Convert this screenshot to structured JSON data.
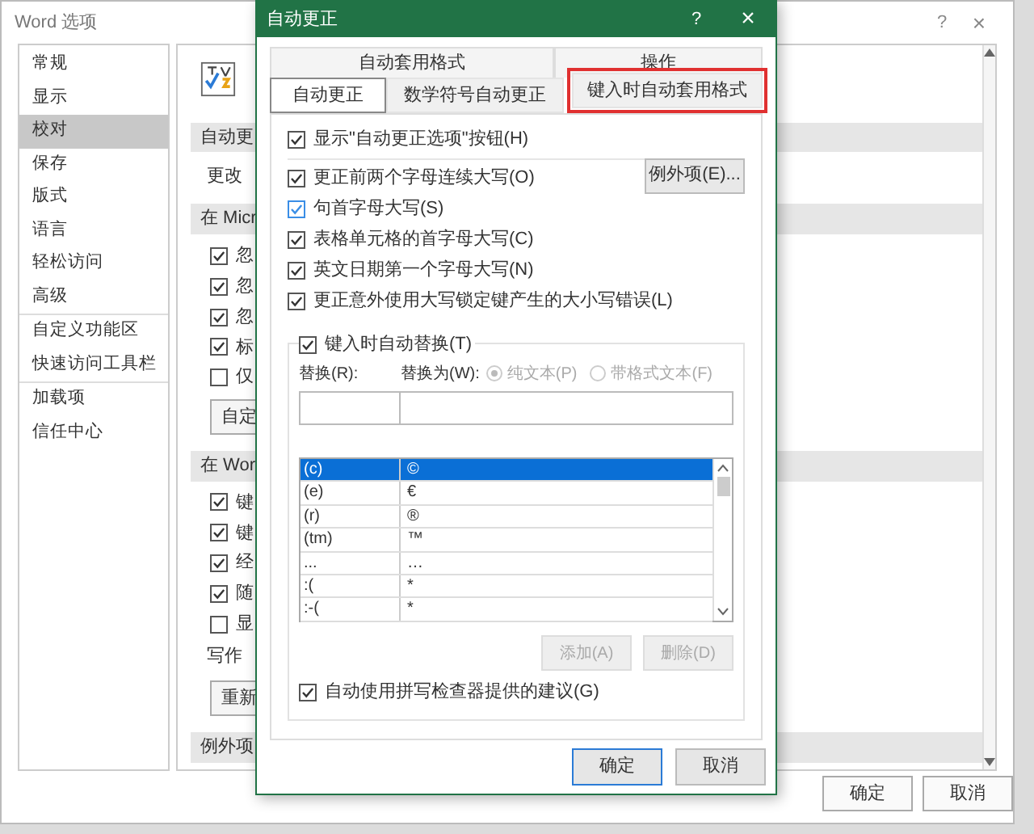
{
  "window": {
    "title": "Word 选项",
    "help": "?",
    "close": "×"
  },
  "sidebar": {
    "groups": [
      [
        {
          "label": "常规",
          "selected": false
        },
        {
          "label": "显示",
          "selected": false
        },
        {
          "label": "校对",
          "selected": true
        },
        {
          "label": "保存",
          "selected": false
        },
        {
          "label": "版式",
          "selected": false
        },
        {
          "label": "语言",
          "selected": false
        },
        {
          "label": "轻松访问",
          "selected": false
        },
        {
          "label": "高级",
          "selected": false
        }
      ],
      [
        {
          "label": "自定义功能区",
          "selected": false
        },
        {
          "label": "快速访问工具栏",
          "selected": false
        }
      ],
      [
        {
          "label": "加载项",
          "selected": false
        },
        {
          "label": "信任中心",
          "selected": false
        }
      ]
    ]
  },
  "main": {
    "rows": [
      {
        "kind": "section",
        "text": "自动更"
      },
      {
        "kind": "text",
        "text": "更改"
      },
      {
        "kind": "section",
        "text": "在 Micr"
      },
      {
        "kind": "check",
        "text": "忽",
        "checked": true
      },
      {
        "kind": "check",
        "text": "忽",
        "checked": true
      },
      {
        "kind": "check",
        "text": "忽",
        "checked": true
      },
      {
        "kind": "check",
        "text": "标",
        "checked": true
      },
      {
        "kind": "check",
        "text": "仅",
        "checked": false
      },
      {
        "kind": "button",
        "text": "自定"
      },
      {
        "kind": "section",
        "text": "在 Wor"
      },
      {
        "kind": "check",
        "text": "键",
        "checked": true
      },
      {
        "kind": "check",
        "text": "键",
        "checked": true
      },
      {
        "kind": "check",
        "text": "经",
        "checked": true
      },
      {
        "kind": "check",
        "text": "随",
        "checked": true
      },
      {
        "kind": "check",
        "text": "显",
        "checked": false
      },
      {
        "kind": "text",
        "text": "写作"
      },
      {
        "kind": "button",
        "text": "重新"
      },
      {
        "kind": "section",
        "text": "例外项"
      }
    ]
  },
  "footer_buttons": [
    "确定",
    "取消"
  ],
  "dialog": {
    "title": "自动更正",
    "help": "?",
    "close": "×",
    "tabs_back": [
      {
        "label": "自动套用格式",
        "selected": false
      },
      {
        "label": "操作",
        "selected": false
      }
    ],
    "tabs_front": [
      {
        "label": "自动更正",
        "selected": true,
        "highlighted": false
      },
      {
        "label": "数学符号自动更正",
        "selected": false,
        "highlighted": false
      },
      {
        "label": "键入时自动套用格式",
        "selected": false,
        "highlighted": true
      }
    ],
    "show_button_option": {
      "text": "显示\"自动更正选项\"按钮(H)",
      "checked": true
    },
    "options": [
      {
        "text": "更正前两个字母连续大写(O)",
        "checked": true
      },
      {
        "text": "句首字母大写(S)",
        "checked": true
      },
      {
        "text": "表格单元格的首字母大写(C)",
        "checked": true
      },
      {
        "text": "英文日期第一个字母大写(N)",
        "checked": true
      },
      {
        "text": "更正意外使用大写锁定键产生的大小写错误(L)",
        "checked": true
      }
    ],
    "exceptions_button": "例外项(E)...",
    "replace_group": {
      "toggle": {
        "text": "键入时自动替换(T)",
        "checked": true
      },
      "replace_label": "替换(R):",
      "with_label": "替换为(W):",
      "radios": [
        {
          "label": "纯文本(P)",
          "selected": true
        },
        {
          "label": "带格式文本(F)",
          "selected": false
        }
      ],
      "rows": [
        {
          "from": "(c)",
          "to": "©",
          "selected": true
        },
        {
          "from": "(e)",
          "to": "€",
          "selected": false
        },
        {
          "from": "(r)",
          "to": "®",
          "selected": false
        },
        {
          "from": "(tm)",
          "to": "™",
          "selected": false
        },
        {
          "from": "...",
          "to": "…",
          "selected": false
        },
        {
          "from": ":(",
          "to": "*",
          "selected": false
        },
        {
          "from": ":-(",
          "to": "*",
          "selected": false
        }
      ],
      "buttons": [
        "添加(A)",
        "删除(D)"
      ],
      "spell_option": {
        "text": "自动使用拼写检查器提供的建议(G)",
        "checked": true
      }
    },
    "buttons": [
      "确定",
      "取消"
    ]
  }
}
